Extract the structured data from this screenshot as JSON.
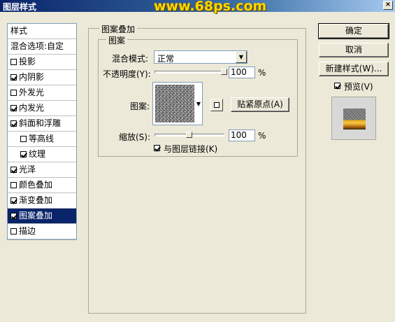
{
  "window": {
    "title": "图层样式",
    "watermark": "www.68ps.com",
    "close_label": "×"
  },
  "sidebar": {
    "items": [
      {
        "label": "样式",
        "checkbox": false,
        "checked": false,
        "selected": false,
        "indent": false
      },
      {
        "label": "混合选项:自定",
        "checkbox": false,
        "checked": false,
        "selected": false,
        "indent": false
      },
      {
        "label": "投影",
        "checkbox": true,
        "checked": false,
        "selected": false,
        "indent": false
      },
      {
        "label": "内阴影",
        "checkbox": true,
        "checked": true,
        "selected": false,
        "indent": false
      },
      {
        "label": "外发光",
        "checkbox": true,
        "checked": false,
        "selected": false,
        "indent": false
      },
      {
        "label": "内发光",
        "checkbox": true,
        "checked": true,
        "selected": false,
        "indent": false
      },
      {
        "label": "斜面和浮雕",
        "checkbox": true,
        "checked": true,
        "selected": false,
        "indent": false
      },
      {
        "label": "等高线",
        "checkbox": true,
        "checked": false,
        "selected": false,
        "indent": true
      },
      {
        "label": "纹理",
        "checkbox": true,
        "checked": true,
        "selected": false,
        "indent": true
      },
      {
        "label": "光泽",
        "checkbox": true,
        "checked": true,
        "selected": false,
        "indent": false
      },
      {
        "label": "颜色叠加",
        "checkbox": true,
        "checked": false,
        "selected": false,
        "indent": false
      },
      {
        "label": "渐变叠加",
        "checkbox": true,
        "checked": true,
        "selected": false,
        "indent": false
      },
      {
        "label": "图案叠加",
        "checkbox": true,
        "checked": true,
        "selected": true,
        "indent": false
      },
      {
        "label": "描边",
        "checkbox": true,
        "checked": false,
        "selected": false,
        "indent": false
      }
    ]
  },
  "panel": {
    "group_title": "图案叠加",
    "sub_group_title": "图案",
    "blend_mode_label": "混合模式:",
    "blend_mode_value": "正常",
    "opacity_label": "不透明度(Y):",
    "opacity_value": "100",
    "opacity_level": 1.0,
    "percent": "%",
    "pattern_label": "图案:",
    "snap_origin_button": "贴紧原点(A)",
    "scale_label": "缩放(S):",
    "scale_value": "100",
    "scale_level": 0.5,
    "link_checkbox_label": "与图层链接(K)",
    "link_checked": true
  },
  "buttons": {
    "ok": "确定",
    "cancel": "取消",
    "new_style": "新建样式(W)...",
    "preview_label": "预览(V)",
    "preview_checked": true
  },
  "colors": {
    "selection": "#0a246a",
    "dialog_bg": "#ece9d8",
    "watermark": "#ffd800"
  }
}
